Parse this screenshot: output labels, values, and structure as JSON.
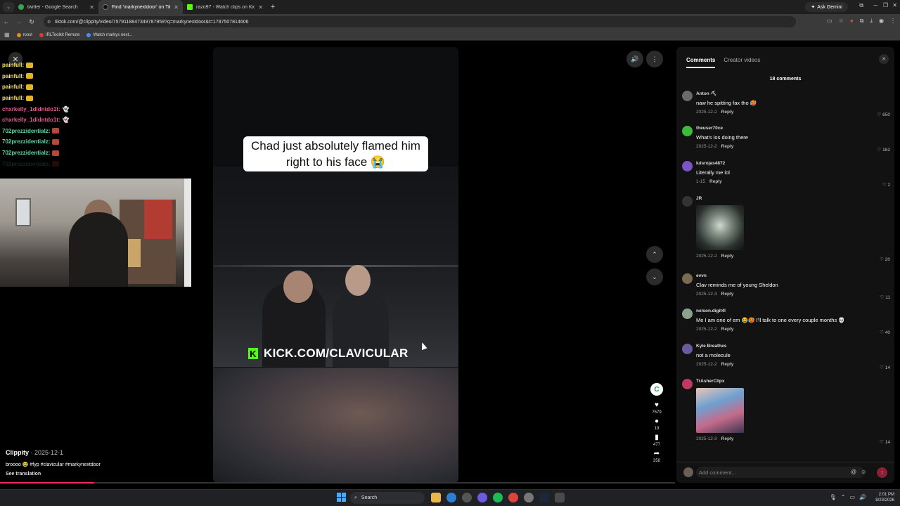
{
  "browser": {
    "tabs": [
      {
        "title": "twitter - Google Search",
        "favicon_color": "#34a853",
        "active": false
      },
      {
        "title": "Find 'markynextdoor' on TikTok",
        "favicon_color": "#111111",
        "active": true
      },
      {
        "title": "razo97 - Watch clips on Kick",
        "favicon_color": "#53fc18",
        "active": false
      }
    ],
    "ask_gemini": "Ask Gemini",
    "url": "tiktok.com/@clippity/video/7579118847349787959?q=markynextdoor&t=1787507814606",
    "bookmarks": [
      {
        "label": "roost",
        "color": "#e08a2c"
      },
      {
        "label": "IRLToolkit Remote",
        "color": "#d9393b"
      },
      {
        "label": "Watch markys next...",
        "color": "#4a8cff"
      }
    ]
  },
  "chat": [
    {
      "user": "painfull:",
      "color": "#f5e36a",
      "emote": "pepe",
      "faded": false
    },
    {
      "user": "painfull:",
      "color": "#f5e36a",
      "emote": "pepe",
      "faded": false
    },
    {
      "user": "painfull:",
      "color": "#f5e36a",
      "emote": "pepe",
      "faded": false
    },
    {
      "user": "painfull:",
      "color": "#f5e36a",
      "emote": "pepe",
      "faded": false
    },
    {
      "user": "chxrkelly_1didntdo1t:",
      "color": "#e05a8c",
      "emote": "ghost",
      "faded": false
    },
    {
      "user": "chxrkelly_1didntdo1t:",
      "color": "#e05a8c",
      "emote": "ghost",
      "faded": false
    },
    {
      "user": "702prezzidentialz:",
      "color": "#5fd6a5",
      "emote": "flag",
      "faded": false
    },
    {
      "user": "702prezzidentialz:",
      "color": "#5fd6a5",
      "emote": "flag",
      "faded": false
    },
    {
      "user": "702prezzidentialz:",
      "color": "#5fd6a5",
      "emote": "flag",
      "faded": false
    },
    {
      "user": "702prezzidentialz:",
      "color": "#5fd6a5",
      "emote": "flag",
      "faded": true
    }
  ],
  "video": {
    "caption_overlay": "Chad just absolutely flamed him right to his face 😭",
    "watermark": "KICK.COM/CLAVICULAR",
    "author": "Clippity",
    "date": "2025-12-1",
    "description": "broooo 😂 #fyp #clavicular #markynextdoor",
    "see_translation": "See translation",
    "progress": 0.14
  },
  "actions": {
    "likes": "7579",
    "comments": "19",
    "saves": "477",
    "shares": "358"
  },
  "comments_panel": {
    "tabs": [
      "Comments",
      "Creator videos"
    ],
    "count_label": "18 comments",
    "reply_label": "Reply",
    "input_placeholder": "Add comment...",
    "comments": [
      {
        "user": "Anton ⛏",
        "text": "naw he spitting fax tho 🥵",
        "date": "2025-12-2",
        "likes": "650",
        "avatar": "#6a6a6a"
      },
      {
        "user": "theuser70ce",
        "text": "What's los doing there",
        "date": "2025-12-2",
        "likes": "162",
        "avatar": "#3dbb3d"
      },
      {
        "user": "luisrojas4872",
        "text": "Literally me lol",
        "date": "1-15",
        "likes": "2",
        "avatar": "#7a55c8"
      },
      {
        "user": "JR",
        "text": "",
        "date": "2025-12-2",
        "likes": "20",
        "avatar": "#333333",
        "image": true
      },
      {
        "user": "evvn",
        "text": "Clav reminds me of young Sheldon",
        "date": "2025-12-3",
        "likes": "11",
        "avatar": "#7b6a52"
      },
      {
        "user": "nelson.digit4l",
        "text": "Me I am one of em 😂🥵 I'll talk to one every couple months 💀",
        "date": "2025-12-2",
        "likes": "40",
        "avatar": "#8aa38a"
      },
      {
        "user": "Kyle Breathes",
        "text": "not a molecule",
        "date": "2025-12-2",
        "likes": "14",
        "avatar": "#6b5aa0"
      },
      {
        "user": "TrAsherClipx",
        "text": "",
        "date": "2025-12-3",
        "likes": "14",
        "avatar": "#c0395e",
        "image": true
      }
    ]
  },
  "taskbar": {
    "search_label": "Search",
    "time": "2:01 PM",
    "date": "8/23/2026"
  }
}
